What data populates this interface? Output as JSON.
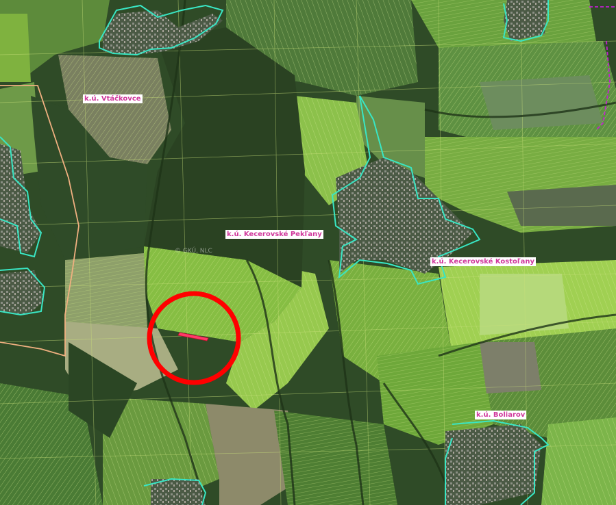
{
  "map": {
    "type": "cadastral aerial map",
    "watermark": "© GKÚ, NLC",
    "cadastral_areas": [
      {
        "name": "k.ú. Vtáčkovce"
      },
      {
        "name": "k.ú. Kecerovské Pekľany"
      },
      {
        "name": "k.ú. Kecerovské Kostoľany"
      },
      {
        "name": "k.ú. Boliarov"
      }
    ],
    "highlight": {
      "shape": "circle",
      "color": "#ff0000",
      "marks": "highlighted parcel"
    },
    "colors": {
      "forest": "#2c4a25",
      "field_light": "#8fc24a",
      "field_mid": "#5f8f3a",
      "village_boundary": "#39e6c4",
      "district_boundary": "#f0b080",
      "parcel_lines": "#c9e07a",
      "parcel_marker": "#ff3a6a"
    }
  }
}
